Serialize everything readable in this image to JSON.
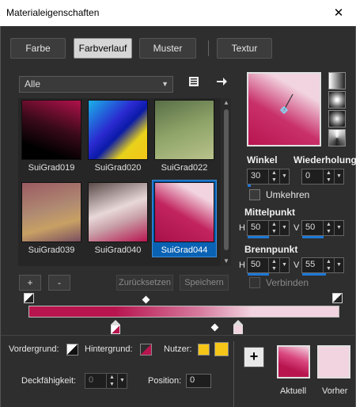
{
  "window": {
    "title": "Materialeigenschaften",
    "close_glyph": "✕"
  },
  "tabs": [
    {
      "label": "Farbe",
      "active": false
    },
    {
      "label": "Farbverlauf",
      "active": true
    },
    {
      "label": "Muster",
      "active": false
    },
    {
      "label": "Textur",
      "active": false
    }
  ],
  "filter": {
    "selected": "Alle"
  },
  "gallery": [
    {
      "name": "SuiGrad019",
      "selected": false
    },
    {
      "name": "SuiGrad020",
      "selected": false
    },
    {
      "name": "SuiGrad022",
      "selected": false
    },
    {
      "name": "SuiGrad039",
      "selected": false
    },
    {
      "name": "SuiGrad040",
      "selected": false
    },
    {
      "name": "SuiGrad044",
      "selected": true
    }
  ],
  "gallery_buttons": {
    "add": "+",
    "remove": "-",
    "reset": "Zurücksetzen",
    "save": "Speichern"
  },
  "angle": {
    "label": "Winkel",
    "value": "30"
  },
  "repeat": {
    "label": "Wiederholung",
    "value": "0"
  },
  "invert": {
    "label": "Umkehren",
    "checked": false
  },
  "center": {
    "label": "Mittelpunkt",
    "h_label": "H",
    "h": "50",
    "v_label": "V",
    "v": "50"
  },
  "focus": {
    "label": "Brennpunkt",
    "h_label": "H",
    "h": "50",
    "v_label": "V",
    "v": "55"
  },
  "link": {
    "label": "Verbinden",
    "checked": false
  },
  "bottom": {
    "foreground_label": "Vordergrund:",
    "background_label": "Hintergrund:",
    "user_label": "Nutzer:",
    "opacity_label": "Deckfähigkeit:",
    "opacity_value": "0",
    "position_label": "Position:",
    "position_value": "0",
    "add_button": "+",
    "current_label": "Aktuell",
    "previous_label": "Vorher"
  },
  "colors": {
    "crimson": "#b8154f",
    "pale_pink": "#f2d4e0",
    "user_yellow": "#f5c518",
    "selection": "#0a62b4"
  }
}
